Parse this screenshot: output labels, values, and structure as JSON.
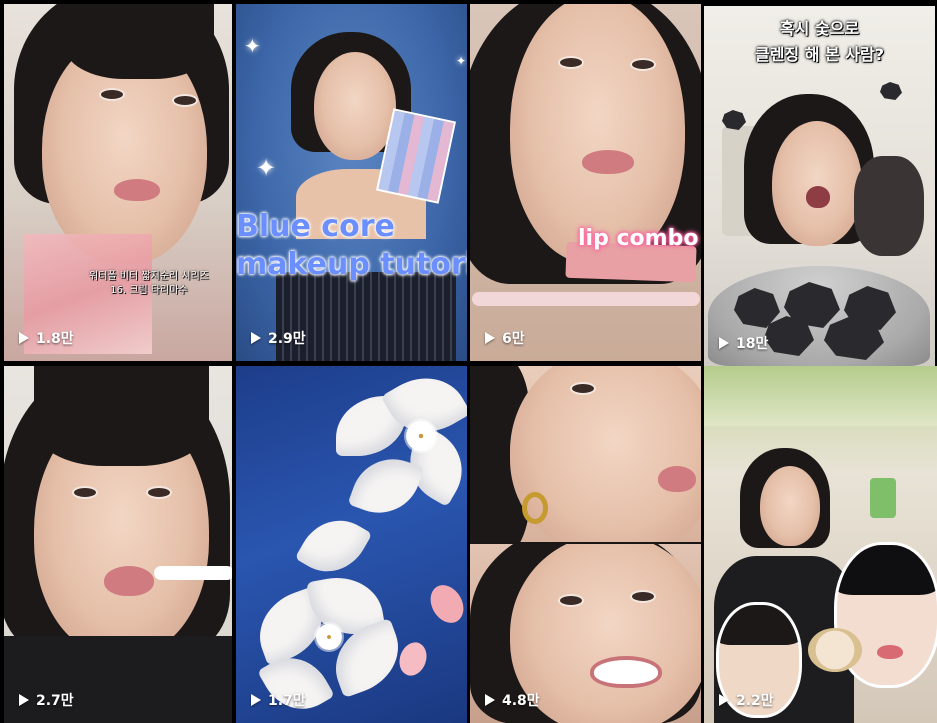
{
  "tiles": [
    {
      "views": "1.8만",
      "caption_lines": [
        "워터폴 비터 짧지순리 시리즈",
        "16. 크림 타리마수"
      ]
    },
    {
      "views": "2.9만",
      "overlay_lines": [
        "Blue core",
        "makeup tutoria"
      ]
    },
    {
      "views": "6만",
      "overlay": "lip combo"
    },
    {
      "views": "18만",
      "caption_lines": [
        "혹시 숯으로",
        "클렌징 해 본 사람?"
      ],
      "selected": true
    },
    {
      "views": "2.7만"
    },
    {
      "views": "1.7만"
    },
    {
      "views": "4.8만"
    },
    {
      "views": "2.2만"
    }
  ],
  "colors": {
    "selected_border": "#e0201b",
    "overlay_blue": "#6b8fff",
    "overlay_pink": "#ff5f9e"
  },
  "icons": {
    "play": "play-icon",
    "sparkle": "sparkle-icon",
    "rock": "charcoal-rock-icon"
  }
}
